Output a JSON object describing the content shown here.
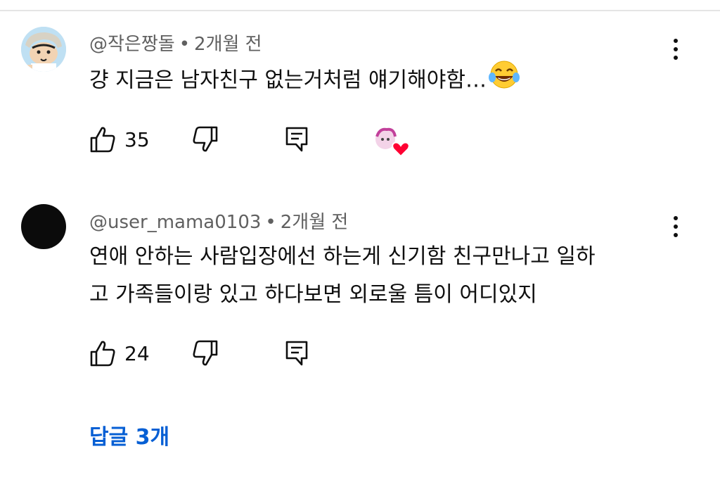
{
  "comments": [
    {
      "author": "@작은짱돌",
      "time": "2개월 전",
      "text": "걍 지금은 남자친구 없는거처럼 얘기해야함…",
      "emoji_icon": "face-with-tears-of-joy-icon",
      "likes": "35",
      "creator_heart": true
    },
    {
      "author": "@user_mama0103",
      "time": "2개월 전",
      "text_line1": "연애 안하는 사람입장에선 하는게 신기함 친구만나고 일하",
      "text_line2": "고 가족들이랑 있고 하다보면 외로울 틈이 어디있지",
      "likes": "24"
    }
  ],
  "meta_separator": "•",
  "replies_label": "답글 3개",
  "colors": {
    "meta_text": "#606060",
    "link_blue": "#065fd4",
    "heart_red": "#ff0033"
  }
}
